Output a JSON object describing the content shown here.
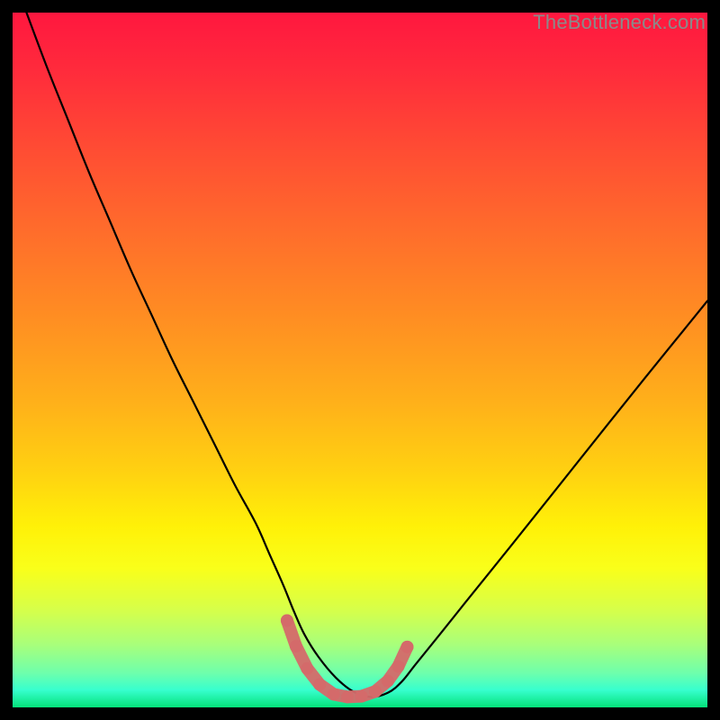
{
  "watermark": "TheBottleneck.com",
  "chart_data": {
    "type": "line",
    "title": "",
    "xlabel": "",
    "ylabel": "",
    "xlim": [
      0,
      100
    ],
    "ylim": [
      0,
      100
    ],
    "grid": false,
    "legend": false,
    "background_gradient": {
      "stops": [
        {
          "offset": 0.0,
          "color": "#ff173f"
        },
        {
          "offset": 0.08,
          "color": "#ff2a3c"
        },
        {
          "offset": 0.2,
          "color": "#ff4d33"
        },
        {
          "offset": 0.32,
          "color": "#ff6e2b"
        },
        {
          "offset": 0.44,
          "color": "#ff8e22"
        },
        {
          "offset": 0.56,
          "color": "#ffb01a"
        },
        {
          "offset": 0.66,
          "color": "#ffd111"
        },
        {
          "offset": 0.74,
          "color": "#fff108"
        },
        {
          "offset": 0.8,
          "color": "#f9ff1a"
        },
        {
          "offset": 0.86,
          "color": "#d6ff4a"
        },
        {
          "offset": 0.91,
          "color": "#a8ff7b"
        },
        {
          "offset": 0.95,
          "color": "#6fffab"
        },
        {
          "offset": 0.975,
          "color": "#37ffce"
        },
        {
          "offset": 1.0,
          "color": "#04e27a"
        }
      ]
    },
    "series": [
      {
        "name": "bottleneck-curve",
        "type": "line",
        "color": "#000000",
        "x": [
          2,
          5,
          8,
          11,
          14,
          17,
          20,
          23,
          26,
          29,
          32,
          35,
          37,
          39,
          40.5,
          42,
          44,
          46.5,
          49,
          51.5,
          54,
          56,
          58,
          61,
          65,
          70,
          76,
          83,
          91,
          100
        ],
        "values": [
          100,
          92,
          84.5,
          77,
          70,
          63,
          56.5,
          50,
          44,
          38,
          32,
          26.5,
          22,
          17.5,
          13.8,
          10.5,
          7.3,
          4.3,
          2.3,
          1.5,
          2.1,
          3.7,
          6.2,
          9.9,
          14.9,
          21.1,
          28.6,
          37.4,
          47.4,
          58.5
        ]
      },
      {
        "name": "flat-bottom-marker",
        "type": "scatter",
        "color": "#d46a6a",
        "marker_size_px": 14,
        "x": [
          39.5,
          40.8,
          42.4,
          44.2,
          46.2,
          48.2,
          50.2,
          52.2,
          54.0,
          55.5,
          56.8
        ],
        "values": [
          12.5,
          8.8,
          5.6,
          3.3,
          1.9,
          1.5,
          1.6,
          2.3,
          3.8,
          5.9,
          8.7
        ]
      }
    ],
    "annotations": []
  }
}
